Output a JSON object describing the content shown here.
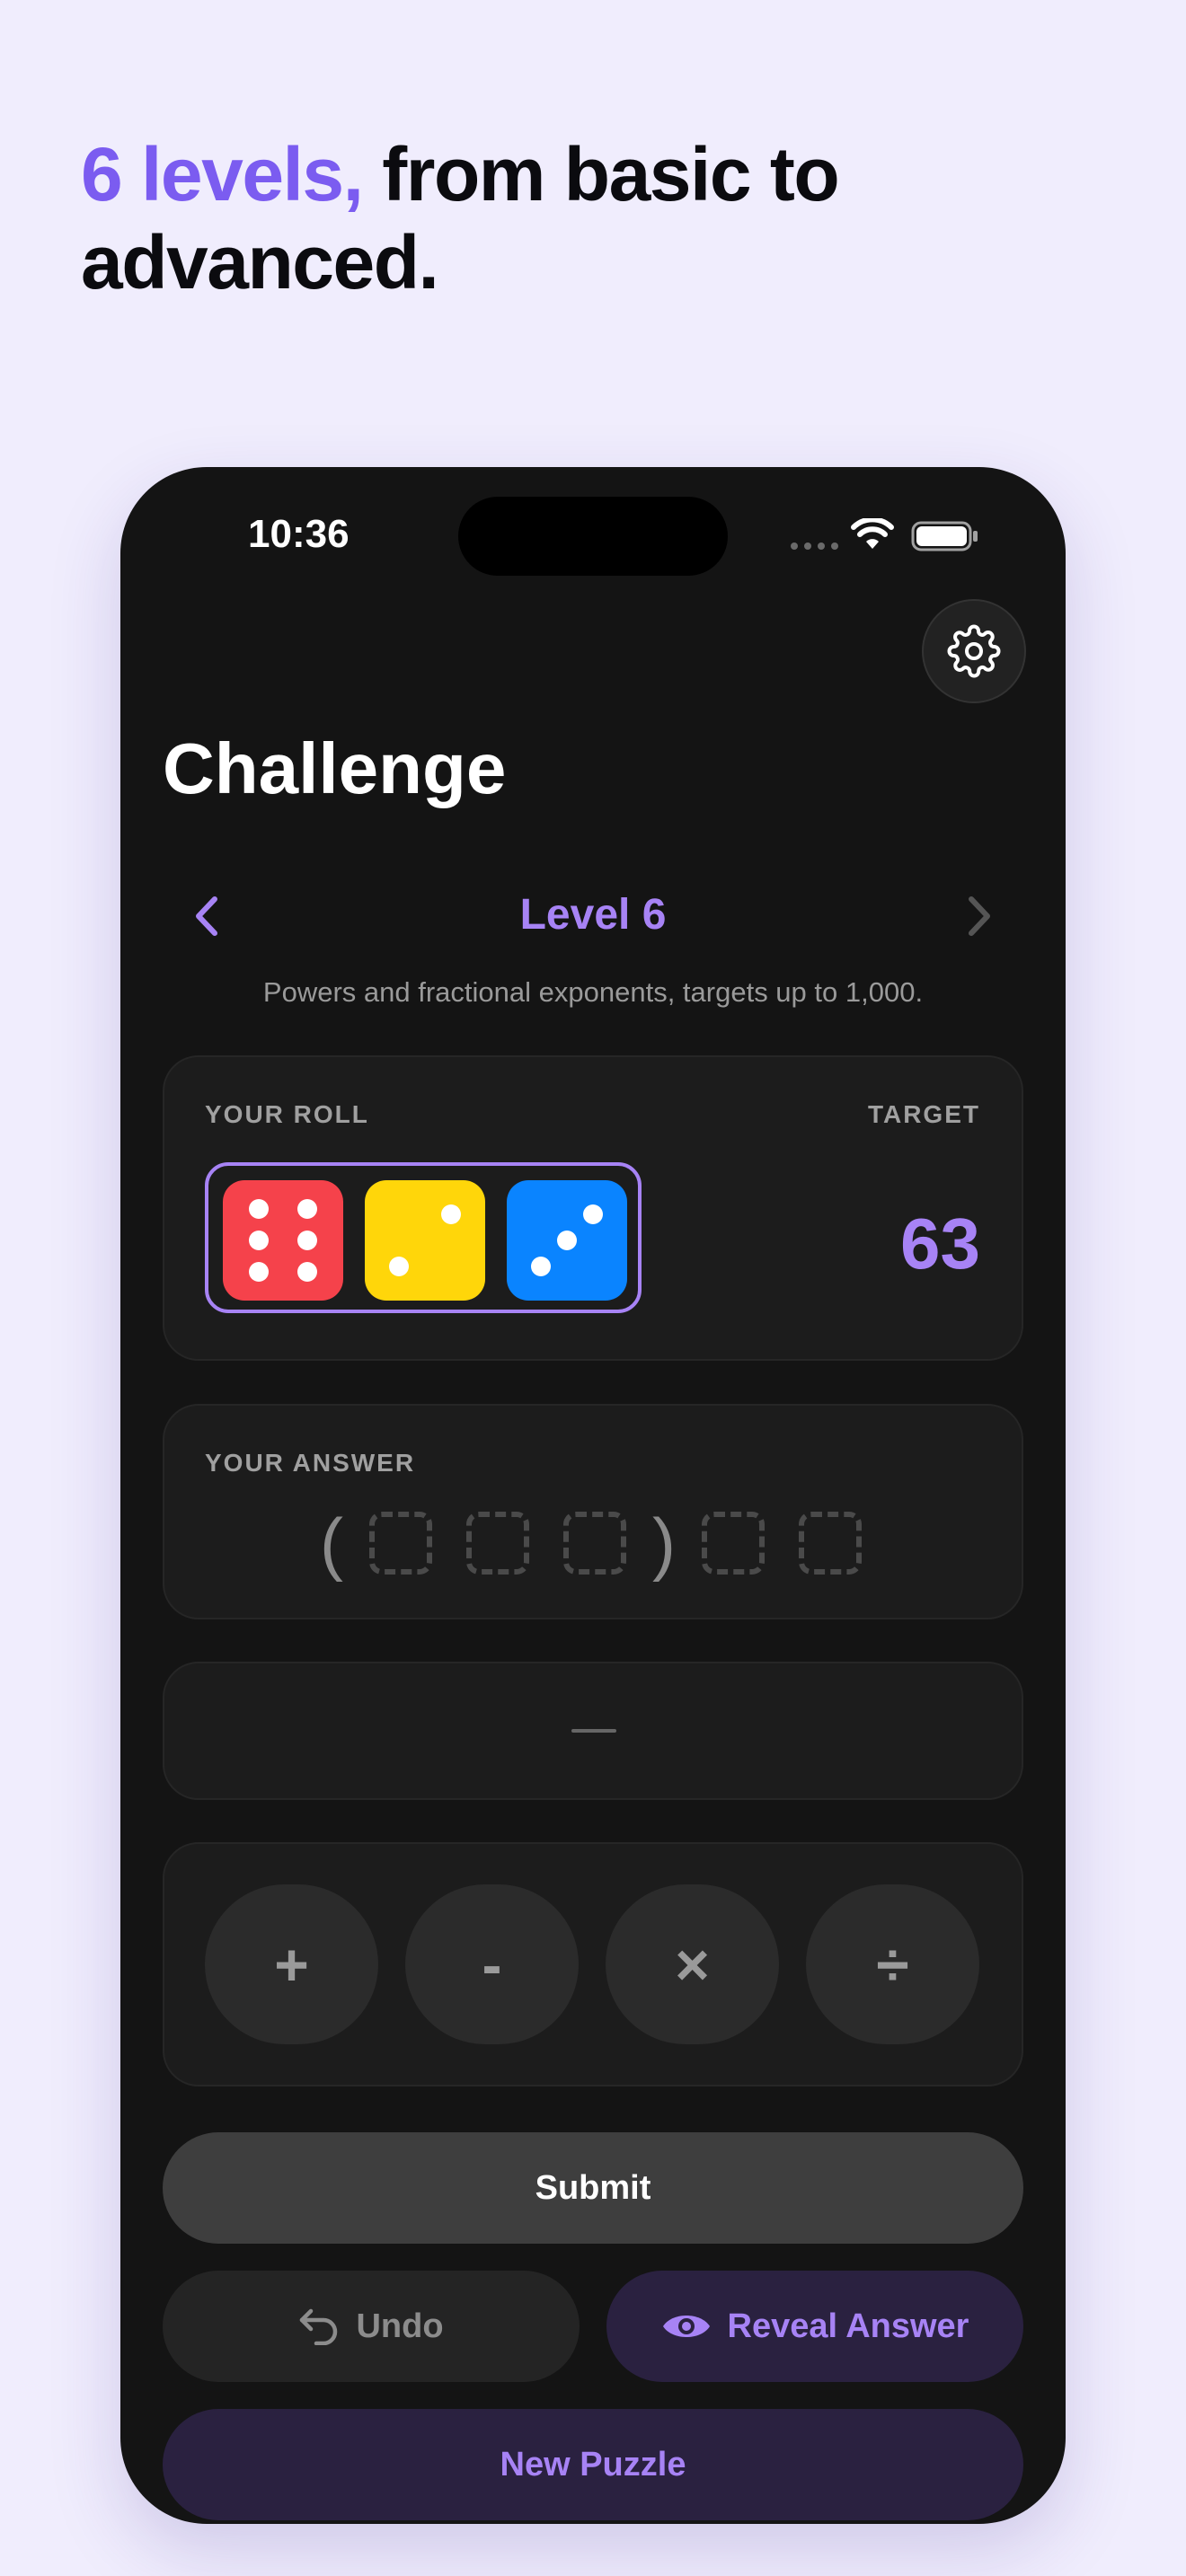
{
  "headline": {
    "accent": "6 levels,",
    "rest": " from basic to advanced."
  },
  "status_bar": {
    "time": "10:36"
  },
  "page_title": "Challenge",
  "level": {
    "label": "Level 6",
    "description": "Powers and fractional exponents, targets up to 1,000."
  },
  "roll": {
    "label": "YOUR ROLL",
    "target_label": "TARGET",
    "target_value": "63",
    "dice": [
      {
        "value": 6,
        "color": "#F5424B"
      },
      {
        "value": 2,
        "color": "#FFD60A"
      },
      {
        "value": 3,
        "color": "#0A84FF"
      }
    ]
  },
  "answer": {
    "label": "YOUR ANSWER"
  },
  "result": {
    "placeholder": "—"
  },
  "operators": [
    "+",
    "-",
    "×",
    "÷"
  ],
  "actions": {
    "submit": "Submit",
    "undo": "Undo",
    "reveal": "Reveal Answer",
    "new_puzzle": "New Puzzle"
  },
  "colors": {
    "accent": "#A783F5",
    "headline_accent": "#7B5CF0",
    "background": "#F0EDFD",
    "phone_bg": "#141414"
  },
  "icons": [
    "gear-icon",
    "chevron-left-icon",
    "chevron-right-icon",
    "undo-icon",
    "eye-icon",
    "wifi-icon",
    "battery-icon"
  ]
}
